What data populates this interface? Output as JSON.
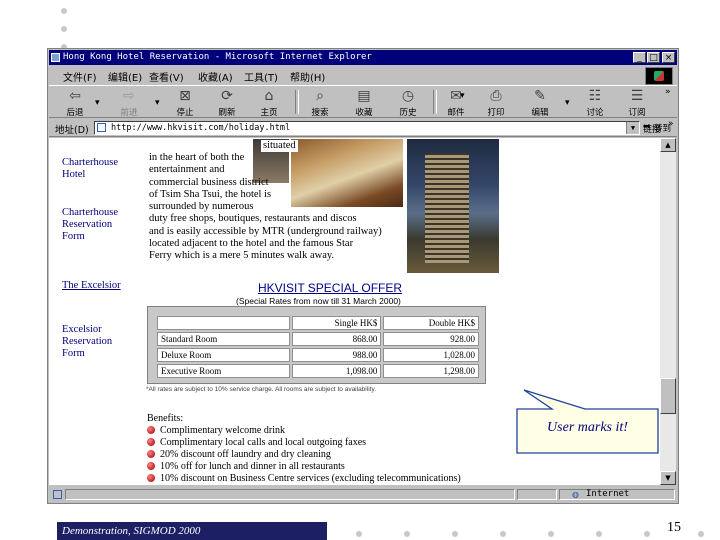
{
  "window": {
    "title": "Hong Kong Hotel Reservation - Microsoft Internet Explorer",
    "controls": [
      "_",
      "□",
      "×"
    ]
  },
  "menu": [
    "文件(F)",
    "编辑(E)",
    "查看(V)",
    "收藏(A)",
    "工具(T)",
    "帮助(H)"
  ],
  "toolbar": {
    "back": "后退",
    "forward": "前进",
    "stop": "停止",
    "refresh": "刷新",
    "home": "主页",
    "search": "搜索",
    "favorites": "收藏",
    "history": "历史",
    "mail": "邮件",
    "print": "打印",
    "edit": "编辑",
    "discuss": "讨论",
    "subscribe": "订阅"
  },
  "address": {
    "label": "地址(D)",
    "url": "http://www.hkvisit.com/holiday.html",
    "go": "转到",
    "links": "链接"
  },
  "sidebar": {
    "links": [
      "Charterhouse Hotel",
      "Charterhouse Reservation Form",
      "The Excelsior",
      "Excelsior Reservation Form"
    ]
  },
  "description": {
    "top": "situated",
    "lines": [
      "in the heart of both the",
      "entertainment and",
      "commercial business district",
      "of Tsim Sha Tsui, the hotel is",
      "surrounded by numerous",
      "duty free shops, boutiques, restaurants and discos",
      "and is easily accessible by MTR (underground railway)",
      "located adjacent to the hotel and the famous Star",
      "Ferry which is a mere 5 minutes walk away."
    ]
  },
  "offer": {
    "title": "HKVISIT SPECIAL OFFER",
    "subtitle": "(Special Rates from now till 31 March 2000)",
    "headers": [
      "",
      "Single HK$",
      "Double HK$"
    ],
    "rows": [
      [
        "Standard Room",
        "868.00",
        "928.00"
      ],
      [
        "Deluxe Room",
        "988.00",
        "1,028.00"
      ],
      [
        "Executive Room",
        "1,098.00",
        "1,298.00"
      ]
    ],
    "note": "*All rates are subject to 10% service charge. All rooms are subject to availability."
  },
  "benefits": {
    "heading": "Benefits:",
    "items": [
      "Complimentary welcome drink",
      "Complimentary local calls and local outgoing faxes",
      "20% discount off laundry and dry cleaning",
      "10% off for lunch and dinner in all restaurants",
      "10% discount on Business Centre services (excluding telecommunications)"
    ]
  },
  "status": {
    "zone": "Internet"
  },
  "callout": {
    "text": "User marks it!"
  },
  "footer": {
    "text": "Demonstration, SIGMOD 2000",
    "page": "15"
  }
}
